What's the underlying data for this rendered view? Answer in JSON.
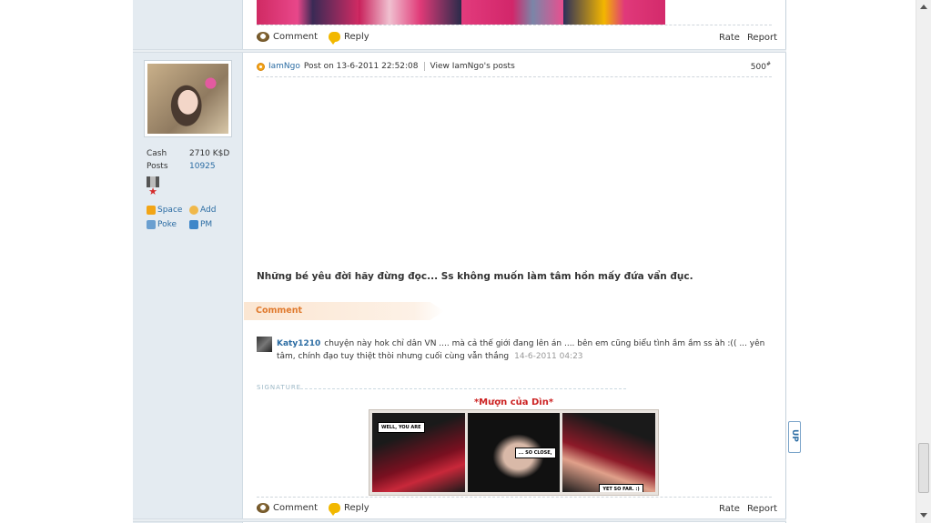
{
  "prev_post": {
    "actions": {
      "comment": "Comment",
      "reply": "Reply",
      "rate": "Rate",
      "report": "Report"
    }
  },
  "post": {
    "author": {
      "name": "IamNgo",
      "cash_label": "Cash",
      "cash_value": "2710 K$D",
      "posts_label": "Posts",
      "posts_value": "10925",
      "links": {
        "space": "Space",
        "add": "Add",
        "poke": "Poke",
        "pm": "PM"
      }
    },
    "header": {
      "post_on": "Post on 13-6-2011 22:52:08",
      "view_posts": "View IamNgo's posts",
      "floor": "500",
      "floor_suffix": "#"
    },
    "body_text": "Những bé yêu đời hãy đừng đọc... Ss không muốn làm tâm hồn mấy đứa vẩn đục.",
    "comment_section_title": "Comment",
    "comments": [
      {
        "user": "Katy1210",
        "text": "chuyện này hok chỉ dân VN .... mà cả thế giới đang lên án .... bên em cũng biểu tình ầm ầm ss àh :(( ... yên tâm, chính đạo tuy thiệt thòi nhưng cuối cùng vẫn thắng",
        "time": "14-6-2011 04:23"
      }
    ],
    "signature": {
      "label": "SIGNATURE",
      "title": "*Mượn của Dìn*",
      "captions": [
        "WELL, YOU ARE",
        "... SO CLOSE,",
        "YET SO FAR. :)"
      ]
    },
    "actions": {
      "comment": "Comment",
      "reply": "Reply",
      "rate": "Rate",
      "report": "Report"
    }
  },
  "up_button": "UP"
}
